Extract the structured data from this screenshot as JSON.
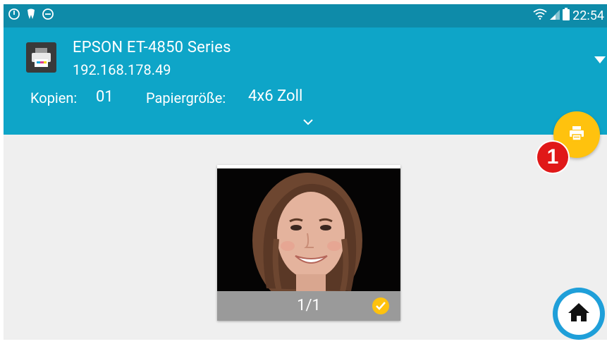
{
  "status_bar": {
    "time": "22:54",
    "left_icons": [
      "power-icon",
      "tooth-icon",
      "do-not-disturb-icon"
    ],
    "right_icons": [
      "wifi-icon",
      "signal-icon",
      "battery-icon"
    ]
  },
  "printer": {
    "name": "EPSON ET-4850 Series",
    "ip": "192.168.178.49"
  },
  "settings": {
    "copies_label": "Kopien:",
    "copies_value": "01",
    "paper_size_label": "Papiergröße:",
    "paper_size_value": "4x6 Zoll"
  },
  "annotation": {
    "step_number": "1"
  },
  "preview": {
    "page_counter": "1/1",
    "selected": true
  },
  "colors": {
    "header": "#0ea5c8",
    "status_bar": "#0e8ba9",
    "fab": "#ffc20e",
    "badge": "#e01818",
    "home_ring": "#1f9fd9"
  }
}
